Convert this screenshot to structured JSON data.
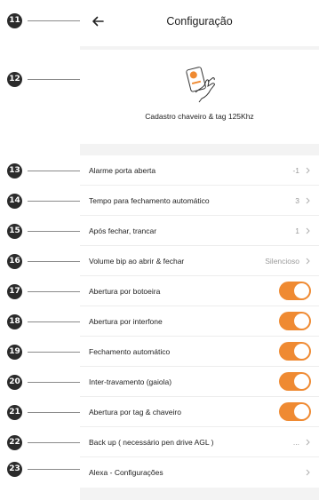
{
  "header": {
    "title": "Configuração"
  },
  "hero": {
    "label": "Cadastro chaveiro & tag 125Khz"
  },
  "callouts": [
    "11",
    "12",
    "13",
    "14",
    "15",
    "16",
    "17",
    "18",
    "19",
    "20",
    "21",
    "22",
    "23"
  ],
  "settings": [
    {
      "label": "Alarme porta aberta",
      "value": "-1"
    },
    {
      "label": "Tempo para fechamento automático",
      "value": "3"
    },
    {
      "label": "Após fechar, trancar",
      "value": "1"
    },
    {
      "label": "Volume bip ao abrir & fechar",
      "value": "Silencioso"
    },
    {
      "label": "Abertura por botoeira",
      "toggle": true
    },
    {
      "label": "Abertura por interfone",
      "toggle": true
    },
    {
      "label": "Fechamento automático",
      "toggle": true
    },
    {
      "label": "Inter-travamento (gaiola)",
      "toggle": true
    },
    {
      "label": "Abertura por tag & chaveiro",
      "toggle": true
    },
    {
      "label": "Back up ( necessário pen drive AGL )",
      "value": "..."
    },
    {
      "label": "Alexa - Configurações",
      "value": ""
    }
  ],
  "colors": {
    "accent": "#ef8a32",
    "badge": "#2b2b2b"
  }
}
